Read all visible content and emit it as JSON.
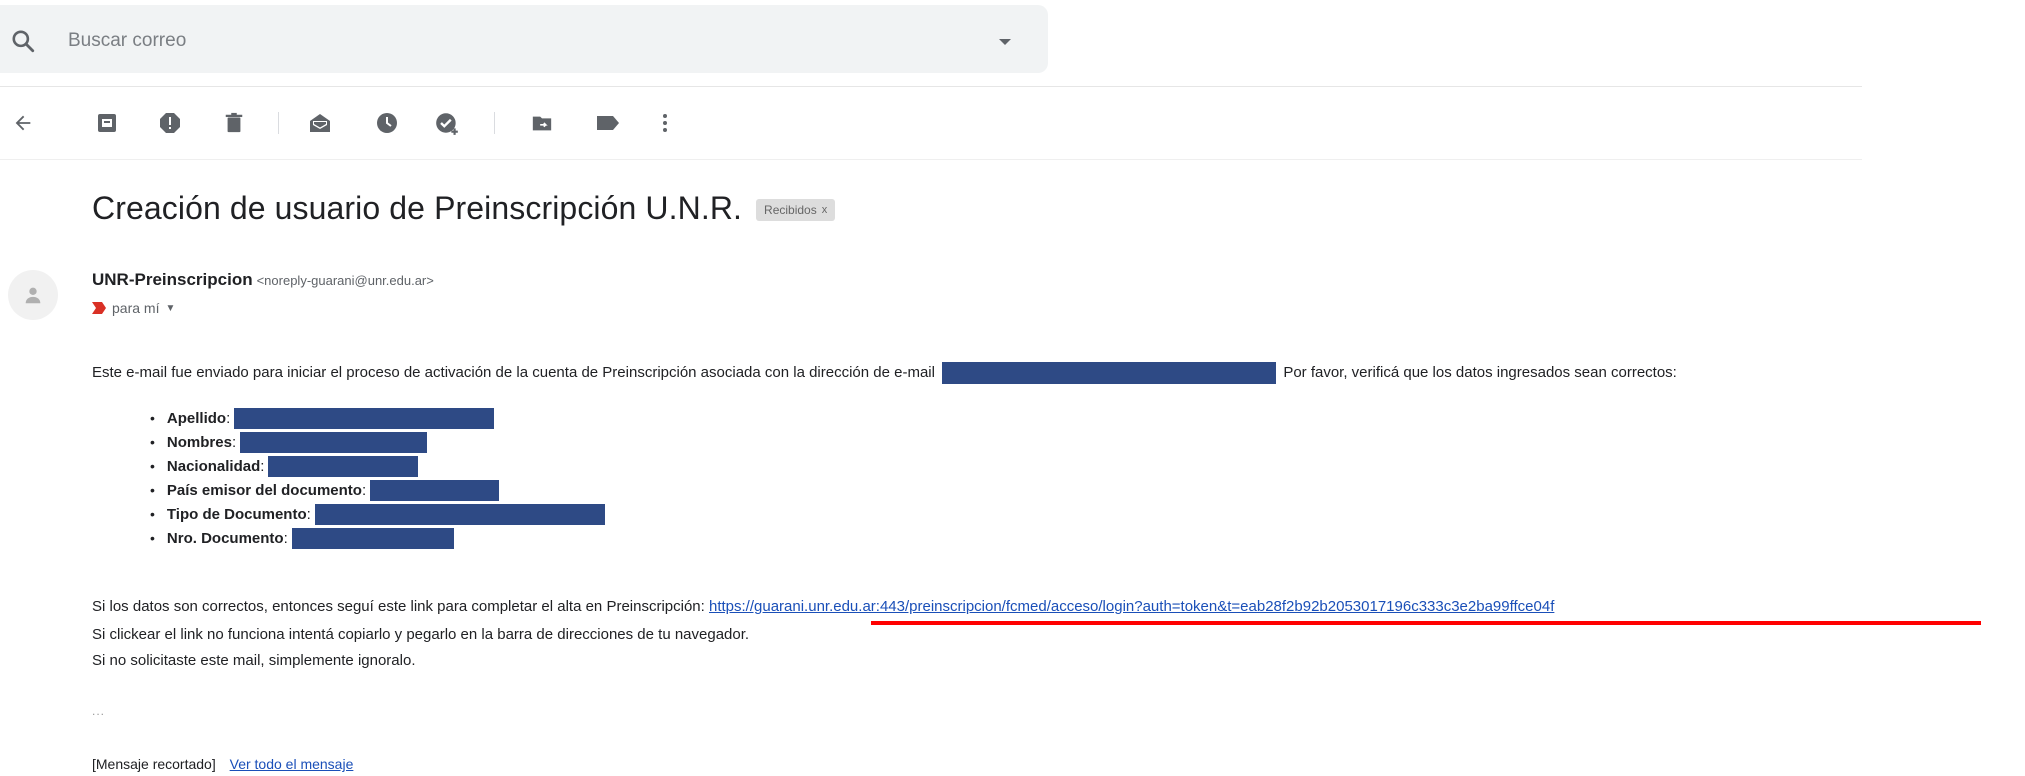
{
  "search": {
    "placeholder": "Buscar correo"
  },
  "toolbar": {
    "icons": [
      "back-arrow-icon",
      "archive-icon",
      "report-spam-icon",
      "delete-icon",
      "mark-unread-icon",
      "snooze-icon",
      "add-to-tasks-icon",
      "move-to-icon",
      "labels-icon",
      "more-vert-icon"
    ]
  },
  "email": {
    "subject": "Creación de usuario de Preinscripción U.N.R.",
    "label": "Recibidos",
    "label_close": "x",
    "sender_name": "UNR-Preinscripcion",
    "sender_email": "<noreply-guarani@unr.edu.ar>",
    "recipient": "para mí",
    "intro_before": "Este e-mail fue enviado para iniciar el proceso de activación de la cuenta de Preinscripción asociada con la dirección de e-mail",
    "intro_after": "Por favor, verificá que los datos ingresados sean correctos:",
    "fields": [
      {
        "label": "Apellido",
        "suffix": ":"
      },
      {
        "label": "Nombres",
        "suffix": ":"
      },
      {
        "label": "Nacionalidad",
        "suffix": ":"
      },
      {
        "label": "País emisor del documento",
        "suffix": ":"
      },
      {
        "label": "Tipo de Documento",
        "suffix": ":"
      },
      {
        "label": "Nro. Documento",
        "suffix": ":"
      }
    ],
    "link_intro": "Si los datos son correctos, entonces seguí este link para completar el alta en Preinscripción:",
    "link_url": "https://guarani.unr.edu.ar:443/preinscripcion/fcmed/acceso/login?auth=token&t=eab28f2b92b2053017196c333c3e2ba99ffce04f",
    "line_copy": "Si clickear el link no funciona intentá copiarlo y pegarlo en la barra de direcciones de tu navegador.",
    "line_ignore": "Si no solicitaste este mail, simplemente ignoralo.",
    "ellipsis": "...",
    "trimmed": "[Mensaje recortado]",
    "view_all": "Ver todo el mensaje"
  },
  "colors": {
    "redaction": "#2e4a85",
    "link": "#1a4fb8",
    "highlight_underline": "#ff0000"
  }
}
